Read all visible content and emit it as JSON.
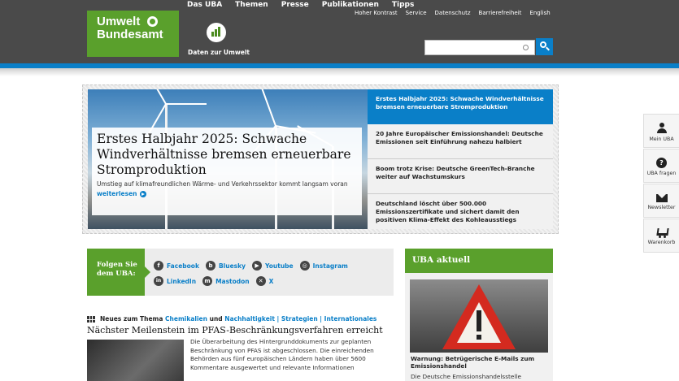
{
  "header": {
    "logo": {
      "line1": "Umwelt",
      "line2": "Bundesamt"
    },
    "main_nav": [
      "Das UBA",
      "Themen",
      "Presse",
      "Publikationen",
      "Tipps"
    ],
    "meta_nav": [
      "Hoher Kontrast",
      "Service",
      "Datenschutz",
      "Barrierefreiheit",
      "English"
    ],
    "data_link": "Daten zur Umwelt",
    "search": {
      "placeholder": "",
      "value": ""
    }
  },
  "hero": {
    "title": "Erstes Halbjahr 2025: Schwache Windverhältnisse bremsen erneuerbare Stromproduktion",
    "subtitle": "Umstieg auf klimafreundlichen Wärme- und Verkehrssektor kommt langsam voran",
    "more": "weiterlesen",
    "items": [
      {
        "text": "Erstes Halbjahr 2025: Schwache Windverhältnisse bremsen erneuerbare Stromproduktion"
      },
      {
        "text": "20 Jahre Europäischer Emissionshandel: Deutsche Emissionen seit Einführung nahezu halbiert"
      },
      {
        "text": "Boom trotz Krise: Deutsche GreenTech-Branche weiter auf Wachstumskurs"
      },
      {
        "text": "Deutschland löscht über 500.000 Emissionszertifikate und sichert damit den positiven Klima-Effekt des Kohleausstiegs"
      }
    ]
  },
  "follow": {
    "label": "Folgen Sie dem UBA:",
    "networks": [
      {
        "name": "Facebook",
        "icon": "f"
      },
      {
        "name": "Bluesky",
        "icon": "b"
      },
      {
        "name": "Youtube",
        "icon": "▶"
      },
      {
        "name": "Instagram",
        "icon": "◎"
      },
      {
        "name": "LinkedIn",
        "icon": "in"
      },
      {
        "name": "Mastodon",
        "icon": "m"
      },
      {
        "name": "X",
        "icon": "✕"
      }
    ]
  },
  "news": {
    "kicker_prefix": "Neues zum Thema",
    "kicker_link1": "Chemikalien",
    "kicker_and": "und",
    "kicker_link2": "Nachhaltigkeit | Strategien | Internationales",
    "title": "Nächster Meilenstein im PFAS-Beschränkungsverfahren erreicht",
    "text": "Die Überarbeitung des Hintergrunddokuments zur geplanten Beschränkung von PFAS ist abgeschlossen. Die einreichenden Behörden aus fünf europäischen Ländern haben über 5600 Kommentare ausgewertet und relevante Informationen"
  },
  "aktuell": {
    "heading": "UBA aktuell",
    "title": "Warnung: Betrügerische E-Mails zum Emissionshandel",
    "desc": "Die Deutsche Emissionshandelsstelle"
  },
  "sidebar": [
    {
      "label": "Mein UBA",
      "icon": "user-icon"
    },
    {
      "label": "UBA fragen",
      "icon": "question-icon"
    },
    {
      "label": "Newsletter",
      "icon": "mail-icon"
    },
    {
      "label": "Warenkorb",
      "icon": "cart-icon"
    }
  ],
  "colors": {
    "green": "#5aa02c",
    "blue": "#0a7fc8",
    "header": "#4a4a4a"
  }
}
